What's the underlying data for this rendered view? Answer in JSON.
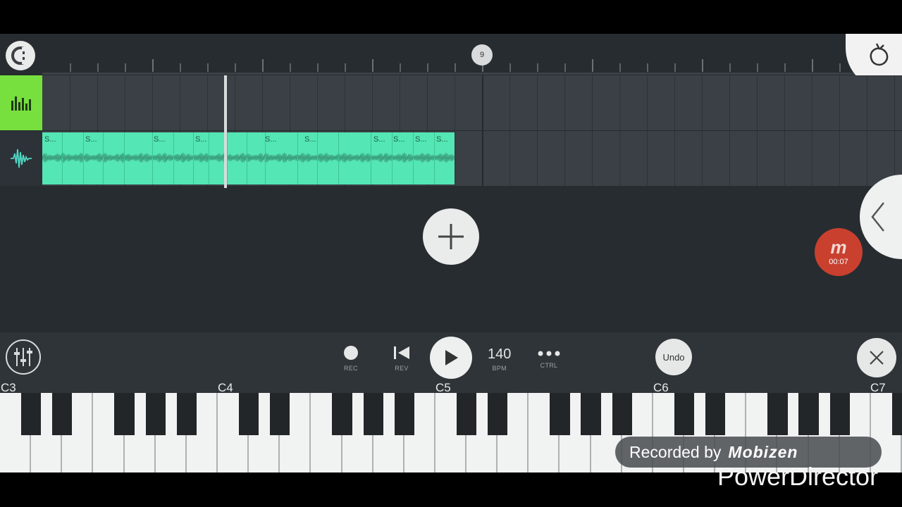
{
  "ruler": {
    "marker": "9"
  },
  "tracks": {
    "clip_labels": [
      "S...",
      "S...",
      "S...",
      "S...",
      "S...",
      "S...",
      "S...",
      "S...",
      "S...",
      "S..."
    ]
  },
  "recorder": {
    "logo": "m",
    "time": "00:07"
  },
  "transport": {
    "rec_label": "REC",
    "rev_label": "REV",
    "bpm_value": "140",
    "bpm_label": "BPM",
    "ctrl_label": "CTRL",
    "undo_label": "Undo"
  },
  "keyboard": {
    "octaves": [
      "C3",
      "C4",
      "C5",
      "C6",
      "C7"
    ]
  },
  "watermarks": {
    "recorded_by": "Recorded by",
    "brand": "Mobizen",
    "editor": "PowerDirector"
  },
  "icons": {
    "logo": "fl-logo-icon",
    "mixer": "mixer-icon",
    "add": "plus-icon",
    "back": "chevron-left-icon",
    "rec": "record-icon",
    "rev": "skip-back-icon",
    "play": "play-icon",
    "ctrl": "more-icon",
    "close": "close-icon"
  },
  "colors": {
    "track1_head": "#77e03e",
    "clip": "#54e6b4",
    "recorder": "#c9402f"
  }
}
